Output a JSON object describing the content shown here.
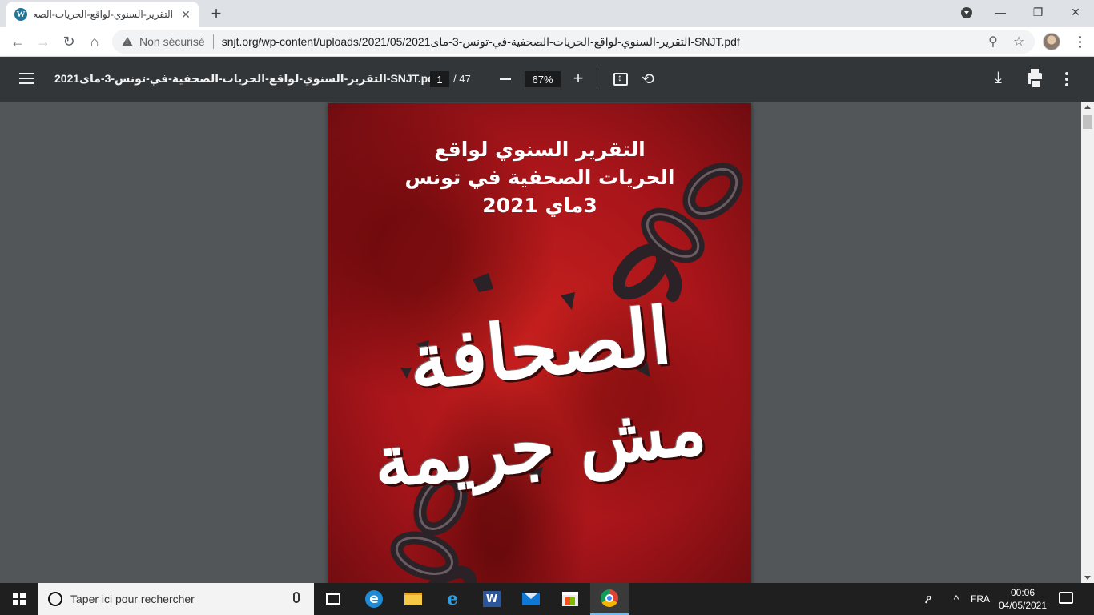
{
  "browser": {
    "tab_title": "التقرير-السنوي-لواقع-الحريات-الصحفية-في-تونس-3-ماى2021-SNJT.pdf",
    "favicon": "W",
    "new_tab": "+",
    "close_tab": "✕",
    "not_secure": "Non sécurisé",
    "url": "snjt.org/wp-content/uploads/2021/05/2021التقرير-السنوي-لواقع-الحريات-الصحفية-في-تونس-3-ماى-SNJT.pdf",
    "win_minimize": "—",
    "win_restore": "❐",
    "win_close": "✕"
  },
  "pdf_viewer": {
    "title": "2021التقرير-السنوي-لواقع-الحريات-الصحفية-في-تونس-3-ماى-SNJT.pdf",
    "current_page": "1",
    "total_pages": "/ 47",
    "zoom": "67%"
  },
  "cover": {
    "heading_line1": "التقرير السنوي لواقع",
    "heading_line2": "الحريات الصحفية في تونس",
    "heading_line3": "3ماي 2021",
    "slogan_line1": "الصحافة",
    "slogan_line2": "مش جريمة",
    "background_color": "#b5181b"
  },
  "taskbar": {
    "search_placeholder": "Taper ici pour rechercher",
    "language": "FRA",
    "time": "00:06",
    "date": "04/05/2021"
  }
}
